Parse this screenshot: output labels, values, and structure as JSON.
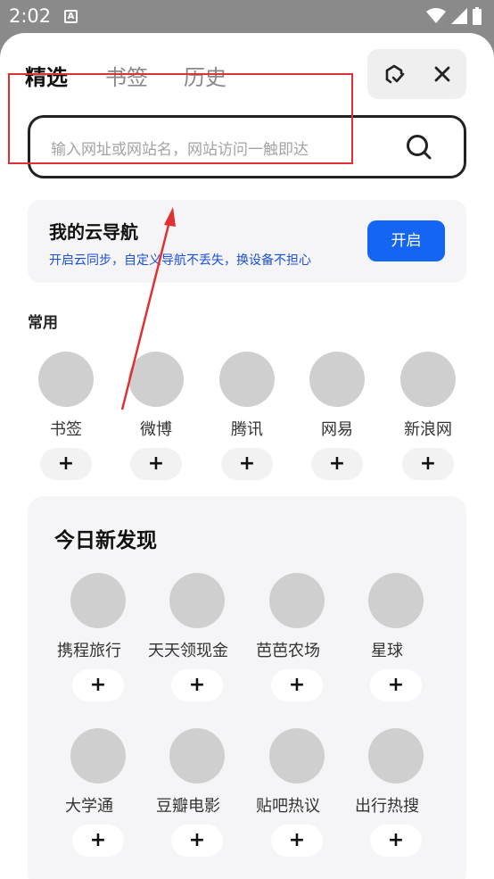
{
  "status_bar": {
    "time": "2:02",
    "notification_glyph": "A"
  },
  "tabs": [
    {
      "label": "精选"
    },
    {
      "label": "书签"
    },
    {
      "label": "历史"
    }
  ],
  "search": {
    "placeholder": "输入网址或网站名，网站访问一触即达"
  },
  "cloud_nav": {
    "title": "我的云导航",
    "subtitle": "开启云同步，自定义导航不丢失，换设备不担心",
    "button": "开启"
  },
  "common": {
    "heading": "常用",
    "items": [
      {
        "label": "书签",
        "add": "+"
      },
      {
        "label": "微博",
        "add": "+"
      },
      {
        "label": "腾讯",
        "add": "+"
      },
      {
        "label": "网易",
        "add": "+"
      },
      {
        "label": "新浪网",
        "add": "+"
      }
    ]
  },
  "discover": {
    "title": "今日新发现",
    "items": [
      {
        "label": "携程旅行",
        "add": "+"
      },
      {
        "label": "天天领现金",
        "add": "+"
      },
      {
        "label": "芭芭农场",
        "add": "+"
      },
      {
        "label": "星球",
        "add": "+"
      },
      {
        "label": "大学通",
        "add": "+"
      },
      {
        "label": "豆瓣电影",
        "add": "+"
      },
      {
        "label": "贴吧热议",
        "add": "+"
      },
      {
        "label": "出行热搜",
        "add": "+"
      }
    ]
  },
  "colors": {
    "accent": "#1565f5",
    "annotation": "#e03030"
  }
}
